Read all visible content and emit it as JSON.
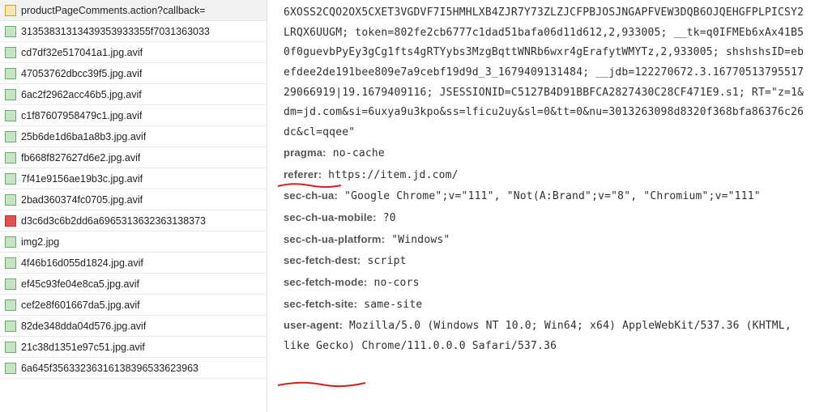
{
  "files": [
    {
      "icon": "js",
      "name": "productPageComments.action?callback="
    },
    {
      "icon": "img",
      "name": "31353831313439353933355f7031363033"
    },
    {
      "icon": "img",
      "name": "cd7df32e517041a1.jpg.avif"
    },
    {
      "icon": "img",
      "name": "47053762dbcc39f5.jpg.avif"
    },
    {
      "icon": "img",
      "name": "6ac2f2962acc46b5.jpg.avif"
    },
    {
      "icon": "img",
      "name": "c1f87607958479c1.jpg.avif"
    },
    {
      "icon": "img",
      "name": "25b6de1d6ba1a8b3.jpg.avif"
    },
    {
      "icon": "img",
      "name": "fb668f827627d6e2.jpg.avif"
    },
    {
      "icon": "img",
      "name": "7f41e9156ae19b3c.jpg.avif"
    },
    {
      "icon": "img",
      "name": "2bad360374fc0705.jpg.avif"
    },
    {
      "icon": "red",
      "name": "d3c6d3c6b2dd6a6965313632363138373"
    },
    {
      "icon": "img",
      "name": "img2.jpg"
    },
    {
      "icon": "img",
      "name": "4f46b16d055d1824.jpg.avif"
    },
    {
      "icon": "img",
      "name": "ef45c93fe04e8ca5.jpg.avif"
    },
    {
      "icon": "img",
      "name": "cef2e8f601667da5.jpg.avif"
    },
    {
      "icon": "img",
      "name": "82de348dda04d576.jpg.avif"
    },
    {
      "icon": "img",
      "name": "21c38d1351e97c51.jpg.avif"
    },
    {
      "icon": "img",
      "name": "6a645f35633236316138396533623963"
    }
  ],
  "headers": {
    "cookie_tail": "6XOSS2CQO2OX5CXET3VGDVF7I5HMHLXB4ZJR7Y73ZLZJCFPBJOSJNGAPFVEW3DQB6OJQEHGFPLPICSY2LRQX6UUGM; token=802fe2cb6777c1dad51bafa06d11d612,2,933005; __tk=q0IFMEb6xAx41B50f0guevbPyEy3gCg1fts4gRTYybs3MzgBqttWNRb6wxr4gErafytWMYTz,2,933005; shshshsID=ebefdee2de191bee809e7a9cebf19d9d_3_1679409131484; __jdb=122270672.3.1677051379551729066919|19.1679409116; JSESSIONID=C5127B4D91BBFCA2827430C28CF471E9.s1; RT=\"z=1&dm=jd.com&si=6uxya9u3kpo&ss=lficu2uy&sl=0&tt=0&nu=3013263098d8320f368bfa86376c26dc&cl=qqee\"",
    "pragma_label": "pragma:",
    "pragma": "no-cache",
    "referer_label": "referer:",
    "referer": "https://item.jd.com/",
    "sec_ch_ua_label": "sec-ch-ua:",
    "sec_ch_ua": "\"Google Chrome\";v=\"111\", \"Not(A:Brand\";v=\"8\", \"Chromium\";v=\"111\"",
    "sec_ch_ua_mobile_label": "sec-ch-ua-mobile:",
    "sec_ch_ua_mobile": "?0",
    "sec_ch_ua_platform_label": "sec-ch-ua-platform:",
    "sec_ch_ua_platform": "\"Windows\"",
    "sec_fetch_dest_label": "sec-fetch-dest:",
    "sec_fetch_dest": "script",
    "sec_fetch_mode_label": "sec-fetch-mode:",
    "sec_fetch_mode": "no-cors",
    "sec_fetch_site_label": "sec-fetch-site:",
    "sec_fetch_site": "same-site",
    "user_agent_label": "user-agent:",
    "user_agent": "Mozilla/5.0 (Windows NT 10.0; Win64; x64) AppleWebKit/537.36 (KHTML, like Gecko) Chrome/111.0.0.0 Safari/537.36"
  }
}
